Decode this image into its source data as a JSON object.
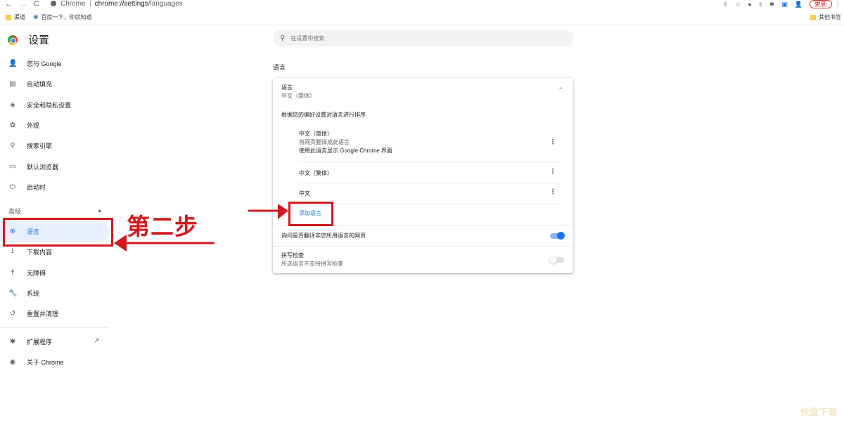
{
  "browser": {
    "back": "←",
    "forward": "→",
    "reload": "C",
    "site_label": "Chrome",
    "url_main": "chrome://settings",
    "url_path": "/languages",
    "update_label": "更新",
    "menu": "⋮",
    "toolbar_icons": [
      "share-icon",
      "star-icon",
      "extension-a-icon",
      "extension-b-icon",
      "puzzle-icon",
      "sidepanel-icon",
      "profile-icon"
    ]
  },
  "bookmarks": {
    "items": [
      {
        "label": "渠道",
        "icon": "folder-icon"
      },
      {
        "label": "百度一下，你就知道",
        "icon": "baidu-icon"
      }
    ],
    "other": "其他书签"
  },
  "sidebar": {
    "title": "设置",
    "items": [
      {
        "label": "您与 Google",
        "icon": "person-icon",
        "glyph": "👤"
      },
      {
        "label": "自动填充",
        "icon": "clipboard-icon",
        "glyph": "▤"
      },
      {
        "label": "安全和隐私设置",
        "icon": "shield-icon",
        "glyph": "◈"
      },
      {
        "label": "外观",
        "icon": "palette-icon",
        "glyph": "✿"
      },
      {
        "label": "搜索引擎",
        "icon": "search-icon",
        "glyph": "⚲"
      },
      {
        "label": "默认浏览器",
        "icon": "browser-icon",
        "glyph": "▭"
      },
      {
        "label": "启动时",
        "icon": "power-icon",
        "glyph": "⏻"
      }
    ],
    "advanced_label": "高级",
    "advanced_chevron": "▴",
    "advanced_items": [
      {
        "label": "语言",
        "icon": "globe-icon",
        "glyph": "⊕",
        "active": true
      },
      {
        "label": "下载内容",
        "icon": "download-icon",
        "glyph": "⭳"
      },
      {
        "label": "无障碍",
        "icon": "accessibility-icon",
        "glyph": "☨"
      },
      {
        "label": "系统",
        "icon": "wrench-icon",
        "glyph": "🔧"
      },
      {
        "label": "重置并清理",
        "icon": "history-icon",
        "glyph": "↺"
      }
    ],
    "extensions_label": "扩展程序",
    "extensions_glyph": "✱",
    "external_glyph": "↗",
    "about_label": "关于 Chrome",
    "about_glyph": "◉"
  },
  "search": {
    "placeholder": "在设置中搜索",
    "glyph": "⚲"
  },
  "languages": {
    "section_title": "语言",
    "card_title": "语言",
    "current": "中文（简体）",
    "chevron": "⌃",
    "order_note": "根据您的偏好设置对语言进行排序",
    "list": [
      {
        "name": "中文（简体）",
        "sub1": "将网页翻译成此语言",
        "sub2": "使用此语言显示 Google Chrome 界面"
      },
      {
        "name": "中文（繁体）"
      },
      {
        "name": "中文"
      }
    ],
    "kebab": "⋮",
    "add_language": "添加语言",
    "offer_translate": {
      "label": "询问是否翻译非您所用语言的网页",
      "enabled": true
    },
    "spell_check": {
      "label": "拼写检查",
      "sub": "所选语言不支持拼写检查",
      "enabled": false
    }
  },
  "annotation": {
    "step_text": "第二步",
    "color": "#d0191f"
  },
  "watermark": "快盘下载"
}
